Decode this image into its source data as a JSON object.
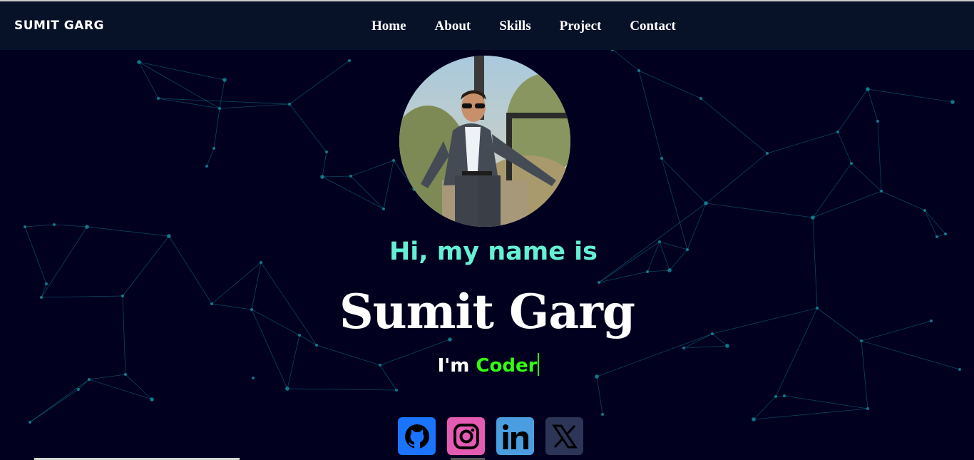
{
  "brand": "SUMIT GARG",
  "nav": [
    "Home",
    "About",
    "Skills",
    "Project",
    "Contact"
  ],
  "hero": {
    "greeting": "Hi, my name is",
    "name": "Sumit Garg",
    "typed_prefix": "I'm",
    "typed_role": "Coder"
  },
  "socials": [
    {
      "icon": "github-icon",
      "color": "#1a74ff"
    },
    {
      "icon": "instagram-icon",
      "color": "#e45bb3"
    },
    {
      "icon": "linkedin-icon",
      "color": "#4a9ee0"
    },
    {
      "icon": "x-icon",
      "color": "#2c3558"
    }
  ],
  "colors": {
    "background": "#01001f",
    "navbar": "#071229",
    "greeting": "#64f0d4",
    "role": "#33ff11",
    "network": "#0f7f8f"
  }
}
